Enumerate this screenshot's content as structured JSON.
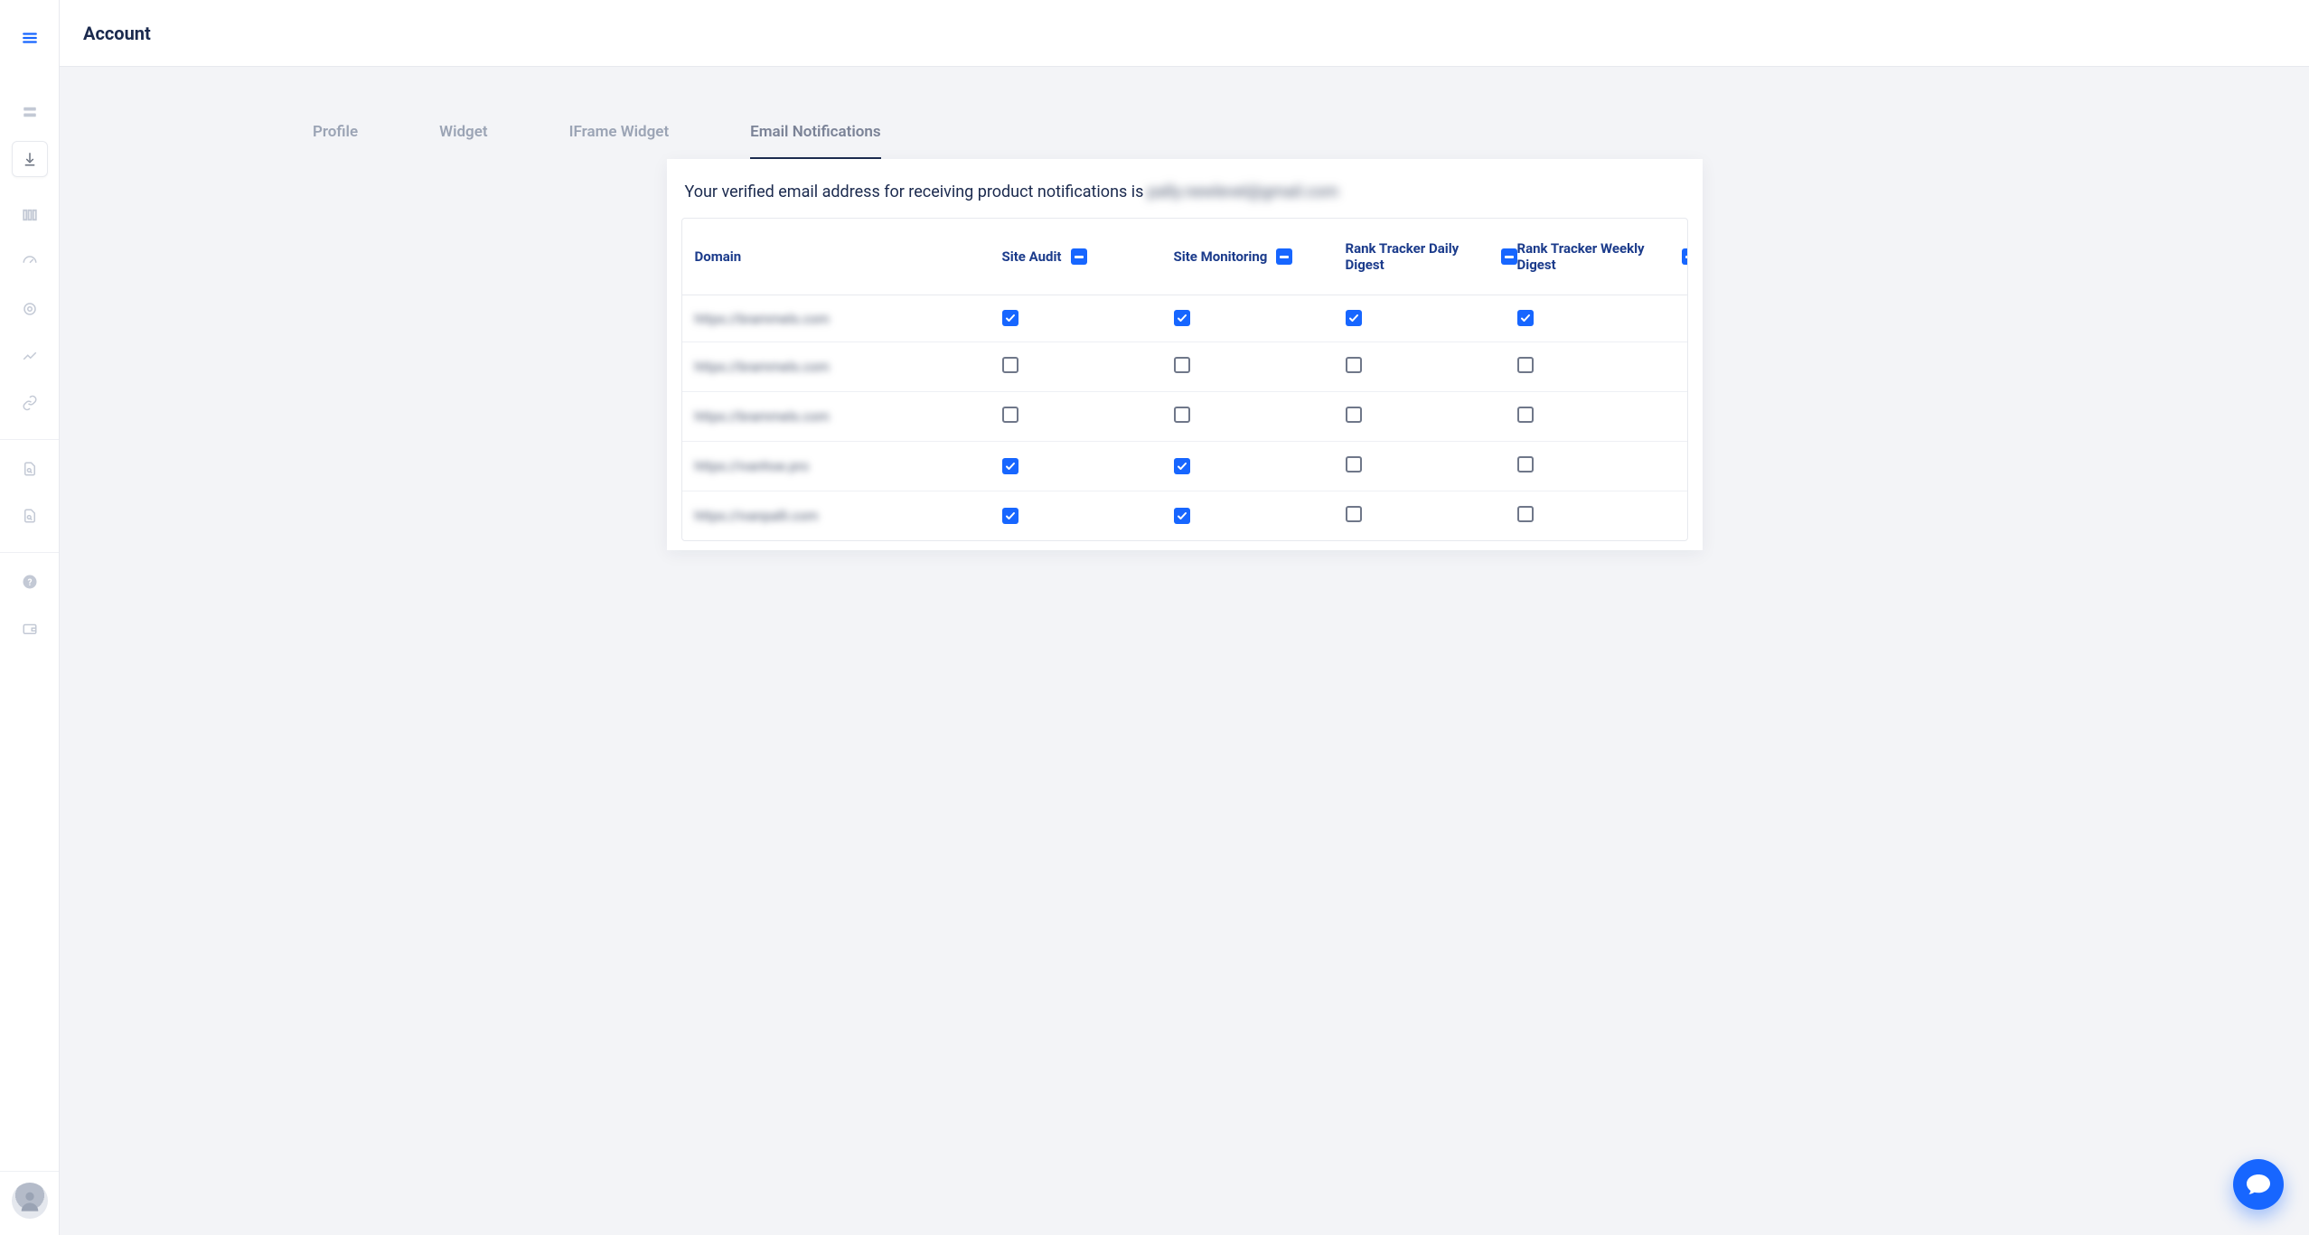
{
  "header": {
    "title": "Account"
  },
  "tabs": {
    "items": [
      {
        "label": "Profile"
      },
      {
        "label": "Widget"
      },
      {
        "label": "IFrame Widget"
      },
      {
        "label": "Email Notifications"
      }
    ],
    "activeIndex": 3
  },
  "notice": {
    "prefix": "Your verified email address for receiving product notifications is ",
    "email": "pally.newlevel@gmail.com"
  },
  "columns": {
    "domain": "Domain",
    "site_audit": "Site Audit",
    "site_monitoring": "Site Monitoring",
    "rank_daily": "Rank Tracker Daily Digest",
    "rank_weekly": "Rank Tracker Weekly Digest"
  },
  "header_checkboxes": {
    "site_audit": "indeterminate",
    "site_monitoring": "indeterminate",
    "rank_daily": "indeterminate",
    "rank_weekly": "indeterminate"
  },
  "rows": [
    {
      "domain": "https://brammels.com",
      "site_audit": true,
      "site_monitoring": true,
      "rank_daily": true,
      "rank_weekly": true
    },
    {
      "domain": "https://brammels.com",
      "site_audit": false,
      "site_monitoring": false,
      "rank_daily": false,
      "rank_weekly": false
    },
    {
      "domain": "https://brammels.com",
      "site_audit": false,
      "site_monitoring": false,
      "rank_daily": false,
      "rank_weekly": false
    },
    {
      "domain": "https://ivanhoe.pro",
      "site_audit": true,
      "site_monitoring": true,
      "rank_daily": false,
      "rank_weekly": false
    },
    {
      "domain": "https://ivanpalli.com",
      "site_audit": true,
      "site_monitoring": true,
      "rank_daily": false,
      "rank_weekly": false
    }
  ],
  "sidebar": {
    "icons": [
      "menu-icon",
      "rows-icon",
      "download-icon",
      "columns-icon",
      "gauge-icon",
      "target-icon",
      "trend-icon",
      "link-icon",
      "doc-search-icon",
      "doc-search-icon",
      "help-icon",
      "wallet-icon"
    ]
  }
}
